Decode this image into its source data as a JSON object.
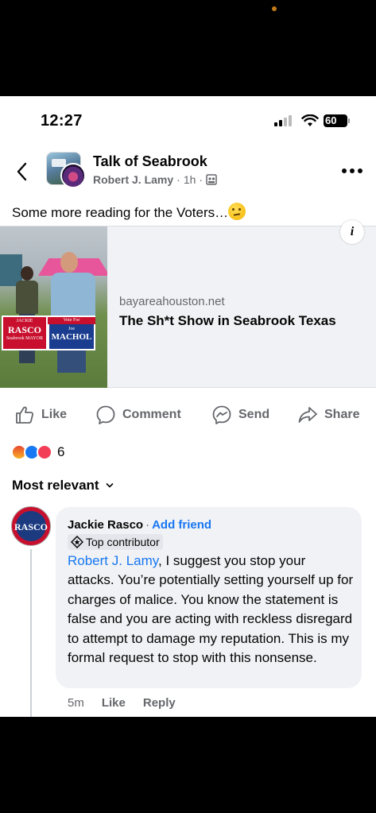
{
  "status_bar": {
    "time": "12:27",
    "battery": "60"
  },
  "header": {
    "group_name": "Talk of Seabrook",
    "author": "Robert J. Lamy",
    "timestamp": "1h"
  },
  "post": {
    "text": "Some more reading for the Voters…",
    "link": {
      "domain": "bayareahouston.net",
      "title": "The Sh*t Show in Seabrook Texas",
      "info_label": "i",
      "image_signs": {
        "sign1_line1": "JACKIE",
        "sign1_line2": "RASCO",
        "sign1_line3": "Seabrook MAYOR",
        "sign2_line1": "Vote For",
        "sign2_line2": "Joe",
        "sign2_line3": "MACHOL"
      }
    }
  },
  "actions": {
    "like": "Like",
    "comment": "Comment",
    "send": "Send",
    "share": "Share"
  },
  "reactions": {
    "count": "6",
    "types": [
      "angry",
      "like",
      "love"
    ]
  },
  "sort": {
    "label": "Most relevant"
  },
  "comment": {
    "avatar_text": "RASCO",
    "author": "Jackie Rasco",
    "add_friend": "Add friend",
    "badge": "Top contributor",
    "mention": "Robert J. Lamy",
    "text": ", I suggest you stop your attacks. You’re potentially setting yourself up for charges of malice. You know the statement is false and you are acting with reckless disregard to attempt to damage my reputation. This is my formal request to stop with this nonsense.",
    "time": "5m",
    "like": "Like",
    "reply": "Reply"
  },
  "colors": {
    "link_blue": "#1877f2",
    "secondary_text": "#65676b",
    "bubble_bg": "#f0f2f5"
  }
}
